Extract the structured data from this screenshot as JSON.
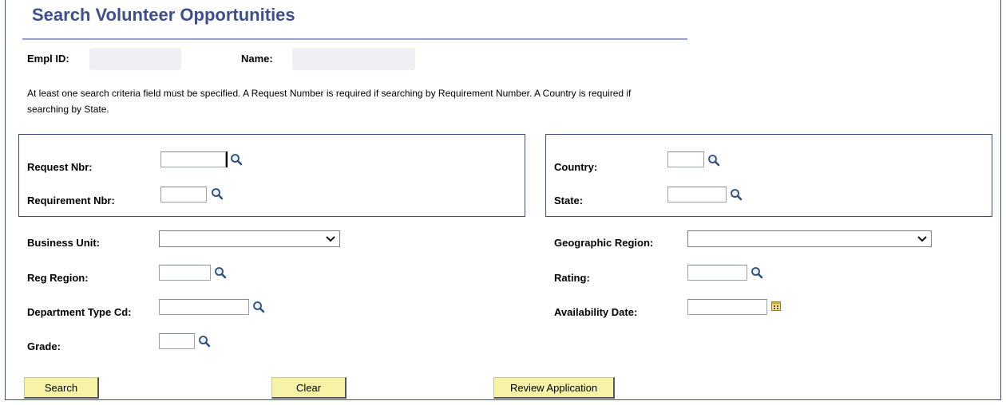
{
  "page": {
    "title": "Search Volunteer Opportunities"
  },
  "employee": {
    "empl_id_label": "Empl ID:",
    "name_label": "Name:"
  },
  "info_text": "At least one search criteria field must be specified. A Request Number is required if searching by Requirement Number. A Country is required if searching by State.",
  "fields": {
    "request_nbr": {
      "label": "Request Nbr:",
      "value": ""
    },
    "requirement_nbr": {
      "label": "Requirement Nbr:",
      "value": ""
    },
    "country": {
      "label": "Country:",
      "value": ""
    },
    "state": {
      "label": "State:",
      "value": ""
    },
    "business_unit": {
      "label": "Business Unit:",
      "value": ""
    },
    "geographic_region": {
      "label": "Geographic Region:",
      "value": ""
    },
    "reg_region": {
      "label": "Reg Region:",
      "value": ""
    },
    "rating": {
      "label": "Rating:",
      "value": ""
    },
    "department_type_cd": {
      "label": "Department Type Cd:",
      "value": ""
    },
    "availability_date": {
      "label": "Availability Date:",
      "value": ""
    },
    "grade": {
      "label": "Grade:",
      "value": ""
    }
  },
  "buttons": {
    "search": "Search",
    "clear": "Clear",
    "review_application": "Review Application"
  },
  "colors": {
    "title": "#3d4f8c",
    "button_bg": "#f6f3a7",
    "border": "#3a4f7a"
  },
  "icons": {
    "lookup": "magnifier-icon",
    "calendar": "calendar-icon",
    "dropdown": "chevron-down-icon"
  }
}
